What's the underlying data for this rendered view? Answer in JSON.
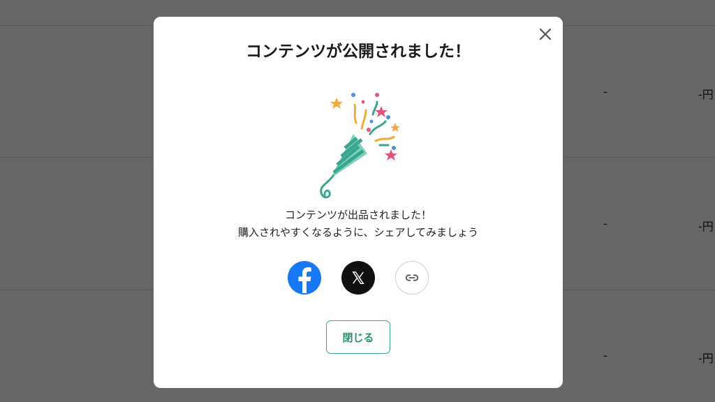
{
  "background": {
    "rows": [
      {
        "col1": "-",
        "col2": "-円"
      },
      {
        "col1": "-",
        "col2": "-円"
      },
      {
        "col1": "-",
        "col2": "-円"
      }
    ]
  },
  "modal": {
    "title": "コンテンツが公開されました！",
    "message_line1": "コンテンツが出品されました！",
    "message_line2": "購入されやすくなるように、シェアしてみましょう",
    "share": {
      "facebook_icon": "facebook-icon",
      "x_icon": "x-icon",
      "link_icon": "link-icon"
    },
    "close_button_label": "閉じる"
  },
  "colors": {
    "overlay": "#000000",
    "facebook": "#1877f2",
    "x": "#111111",
    "accent": "#3aa68f"
  }
}
